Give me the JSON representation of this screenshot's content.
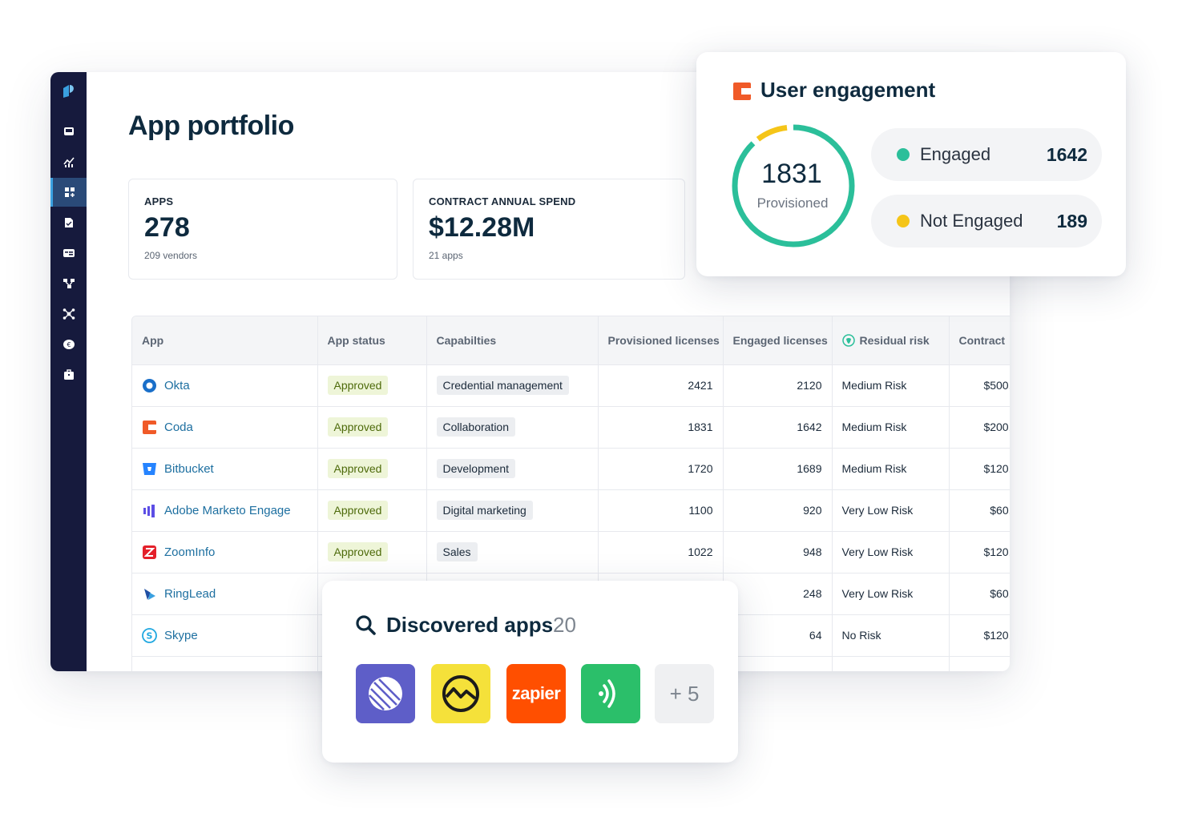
{
  "page": {
    "title": "App portfolio"
  },
  "stats": [
    {
      "label": "APPS",
      "value": "278",
      "sub": "209 vendors"
    },
    {
      "label": "CONTRACT ANNUAL SPEND",
      "value": "$12.28M",
      "sub": "21 apps"
    }
  ],
  "table": {
    "headers": [
      "App",
      "App status",
      "Capabilties",
      "Provisioned licenses",
      "Engaged licenses",
      "Residual risk",
      "Contract"
    ],
    "rows": [
      {
        "app": "Okta",
        "status": "Approved",
        "capability": "Credential management",
        "provisioned": "2421",
        "engaged": "2120",
        "risk": "Medium Risk",
        "contract": "$500,"
      },
      {
        "app": "Coda",
        "status": "Approved",
        "capability": "Collaboration",
        "provisioned": "1831",
        "engaged": "1642",
        "risk": "Medium Risk",
        "contract": "$200,"
      },
      {
        "app": "Bitbucket",
        "status": "Approved",
        "capability": "Development",
        "provisioned": "1720",
        "engaged": "1689",
        "risk": "Medium Risk",
        "contract": "$120,"
      },
      {
        "app": "Adobe Marketo Engage",
        "status": "Approved",
        "capability": "Digital marketing",
        "provisioned": "1100",
        "engaged": "920",
        "risk": "Very Low Risk",
        "contract": "$60,"
      },
      {
        "app": "ZoomInfo",
        "status": "Approved",
        "capability": "Sales",
        "provisioned": "1022",
        "engaged": "948",
        "risk": "Very Low Risk",
        "contract": "$120,"
      },
      {
        "app": "RingLead",
        "status": "",
        "capability": "",
        "provisioned": "",
        "engaged": "248",
        "risk": "Very Low Risk",
        "contract": "$60,"
      },
      {
        "app": "Skype",
        "status": "",
        "capability": "",
        "provisioned": "",
        "engaged": "64",
        "risk": "No Risk",
        "contract": "$120,"
      }
    ]
  },
  "engagement": {
    "title": "User engagement",
    "provisioned_value": "1831",
    "provisioned_label": "Provisioned",
    "engaged_label": "Engaged",
    "engaged_value": "1642",
    "not_engaged_label": "Not Engaged",
    "not_engaged_value": "189",
    "engaged_color": "#2bbf9a",
    "not_engaged_color": "#f5c518"
  },
  "discovered": {
    "title": "Discovered apps",
    "count": "20",
    "tiles": [
      "linear-icon",
      "basecamp-icon",
      "zapier",
      "airtable-cast-icon"
    ],
    "zapier_label": "zapier",
    "more_label": "+ 5"
  },
  "icons": {
    "sidebar": [
      "inbox-icon",
      "analytics-icon",
      "apps-icon",
      "document-icon",
      "billing-icon",
      "workflow-icon",
      "integrations-icon",
      "spend-icon",
      "briefcase-icon"
    ]
  }
}
